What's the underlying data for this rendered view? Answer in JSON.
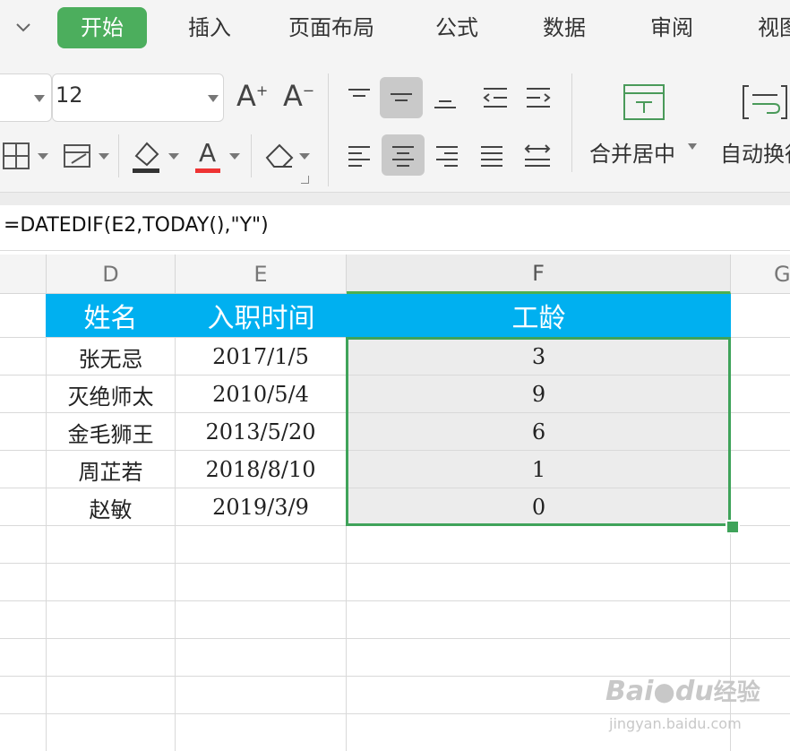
{
  "menu": {
    "tabs": [
      {
        "label": "开始",
        "active": true
      },
      {
        "label": "插入"
      },
      {
        "label": "页面布局"
      },
      {
        "label": "公式"
      },
      {
        "label": "数据"
      },
      {
        "label": "审阅"
      },
      {
        "label": "视图"
      }
    ]
  },
  "ribbon": {
    "font_size": "12",
    "font_grow": "A",
    "font_shrink": "A",
    "merge_center_label": "合并居中",
    "auto_wrap_label": "自动换行",
    "font_color_glyph": "A"
  },
  "formula_bar": {
    "formula": "=DATEDIF(E2,TODAY(),\"Y\")"
  },
  "sheet": {
    "column_headers": [
      "D",
      "E",
      "F",
      "G"
    ],
    "header_row": [
      "姓名",
      "入职时间",
      "工龄"
    ],
    "header_color": "#00b0f0",
    "selection_color": "#3fa35a",
    "rows": [
      {
        "name": "张无忌",
        "date": "2017/1/5",
        "years": "3"
      },
      {
        "name": "灭绝师太",
        "date": "2010/5/4",
        "years": "9"
      },
      {
        "name": "金毛狮王",
        "date": "2013/5/20",
        "years": "6"
      },
      {
        "name": "周芷若",
        "date": "2018/8/10",
        "years": "1"
      },
      {
        "name": "赵敏",
        "date": "2019/3/9",
        "years": "0"
      }
    ]
  },
  "watermark": {
    "brand": "Bai",
    "brand2": "du",
    "site_cn": "经验",
    "url": "jingyan.baidu.com"
  }
}
